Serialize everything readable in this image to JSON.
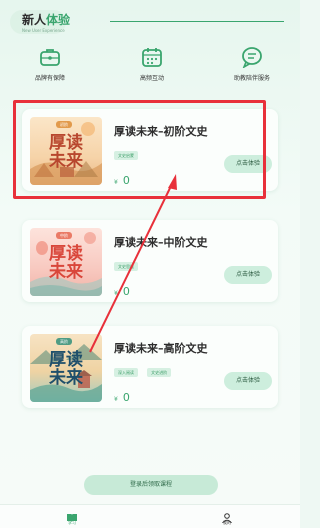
{
  "header": {
    "title_part1": "新人",
    "title_part2": "体验",
    "subtitle": "New User Experience"
  },
  "features": [
    {
      "icon": "briefcase-icon",
      "label": "品牌有保障"
    },
    {
      "icon": "calendar-icon",
      "label": "高频互动"
    },
    {
      "icon": "chat-icon",
      "label": "助教陪伴服务"
    }
  ],
  "courses": [
    {
      "cover_level": "初阶",
      "cover_title_1": "厚读",
      "cover_title_2": "未来",
      "name": "厚读未来–初阶文史",
      "tags": [
        "文史启蒙"
      ],
      "currency": "¥",
      "price": "0",
      "button": "点击体验"
    },
    {
      "cover_level": "中阶",
      "cover_title_1": "厚读",
      "cover_title_2": "未来",
      "name": "厚读未来–中阶文史",
      "tags": [
        "文史思维"
      ],
      "currency": "¥",
      "price": "0",
      "button": "点击体验"
    },
    {
      "cover_level": "高阶",
      "cover_title_1": "厚读",
      "cover_title_2": "未来",
      "name": "厚读未来–高阶文史",
      "tags": [
        "深入阅读",
        "文史进阶"
      ],
      "currency": "¥",
      "price": "0",
      "button": "点击体验"
    }
  ],
  "login_button": "登录后领取课程",
  "tabbar": [
    {
      "icon": "book-icon",
      "label": "学习",
      "active": true
    },
    {
      "icon": "user-icon",
      "label": "我的",
      "active": false
    }
  ],
  "colors": {
    "accent": "#3aa56e",
    "annotation": "#e8303a"
  }
}
